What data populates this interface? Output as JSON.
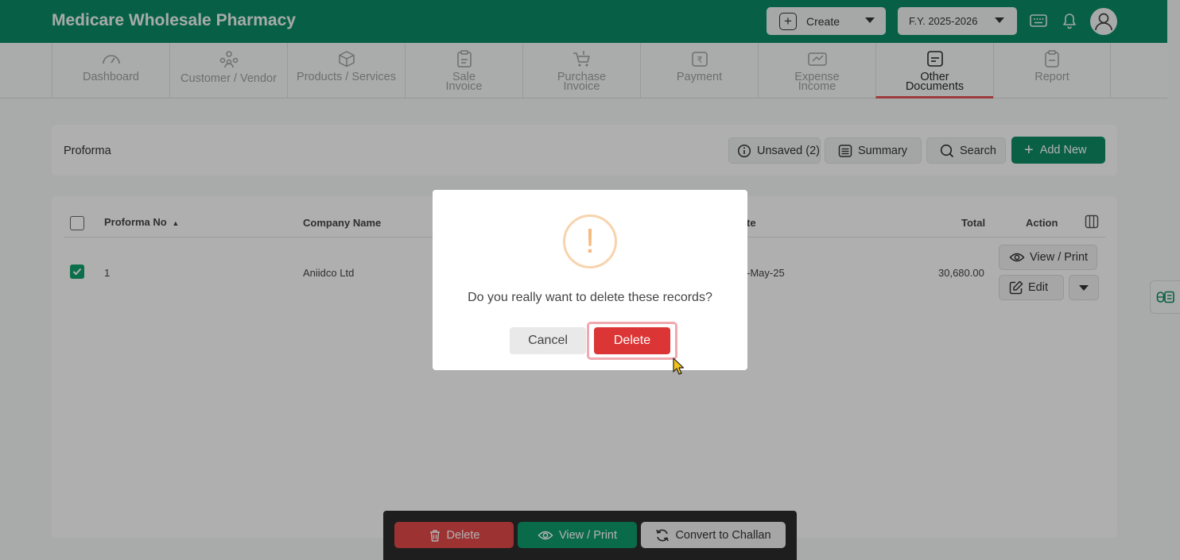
{
  "header": {
    "app_title": "Medicare Wholesale Pharmacy",
    "create_label": "Create",
    "fy_label": "F.Y. 2025-2026",
    "brand_color": "#0b8a63"
  },
  "nav": {
    "items": [
      {
        "line1": "Dashboard",
        "line2": ""
      },
      {
        "line1": "Customer / Vendor",
        "line2": ""
      },
      {
        "line1": "Products / Services",
        "line2": ""
      },
      {
        "line1": "Sale",
        "line2": "Invoice"
      },
      {
        "line1": "Purchase",
        "line2": "Invoice"
      },
      {
        "line1": "Payment",
        "line2": ""
      },
      {
        "line1": "Expense",
        "line2": "Income"
      },
      {
        "line1": "Other",
        "line2": "Documents"
      },
      {
        "line1": "Report",
        "line2": ""
      }
    ],
    "active_index": 7
  },
  "toolbar": {
    "title": "Proforma",
    "unsaved_label": "Unsaved (2)",
    "summary_label": "Summary",
    "search_label": "Search",
    "add_new_label": "Add New"
  },
  "table": {
    "columns": {
      "proforma_no": "Proforma No",
      "company_name": "Company Name",
      "date": "te",
      "total": "Total",
      "action": "Action"
    },
    "rows": [
      {
        "proforma_no": "1",
        "company_name": "Aniidco Ltd",
        "date": "-May-25",
        "total": "30,680.00",
        "checked": true
      }
    ],
    "view_print_label": "View / Print",
    "edit_label": "Edit"
  },
  "action_bar": {
    "delete_label": "Delete",
    "view_print_label": "View / Print",
    "convert_label": "Convert to Challan"
  },
  "modal": {
    "icon_glyph": "!",
    "message": "Do you really want to delete these records?",
    "cancel_label": "Cancel",
    "delete_label": "Delete",
    "danger_color": "#dc3535"
  }
}
